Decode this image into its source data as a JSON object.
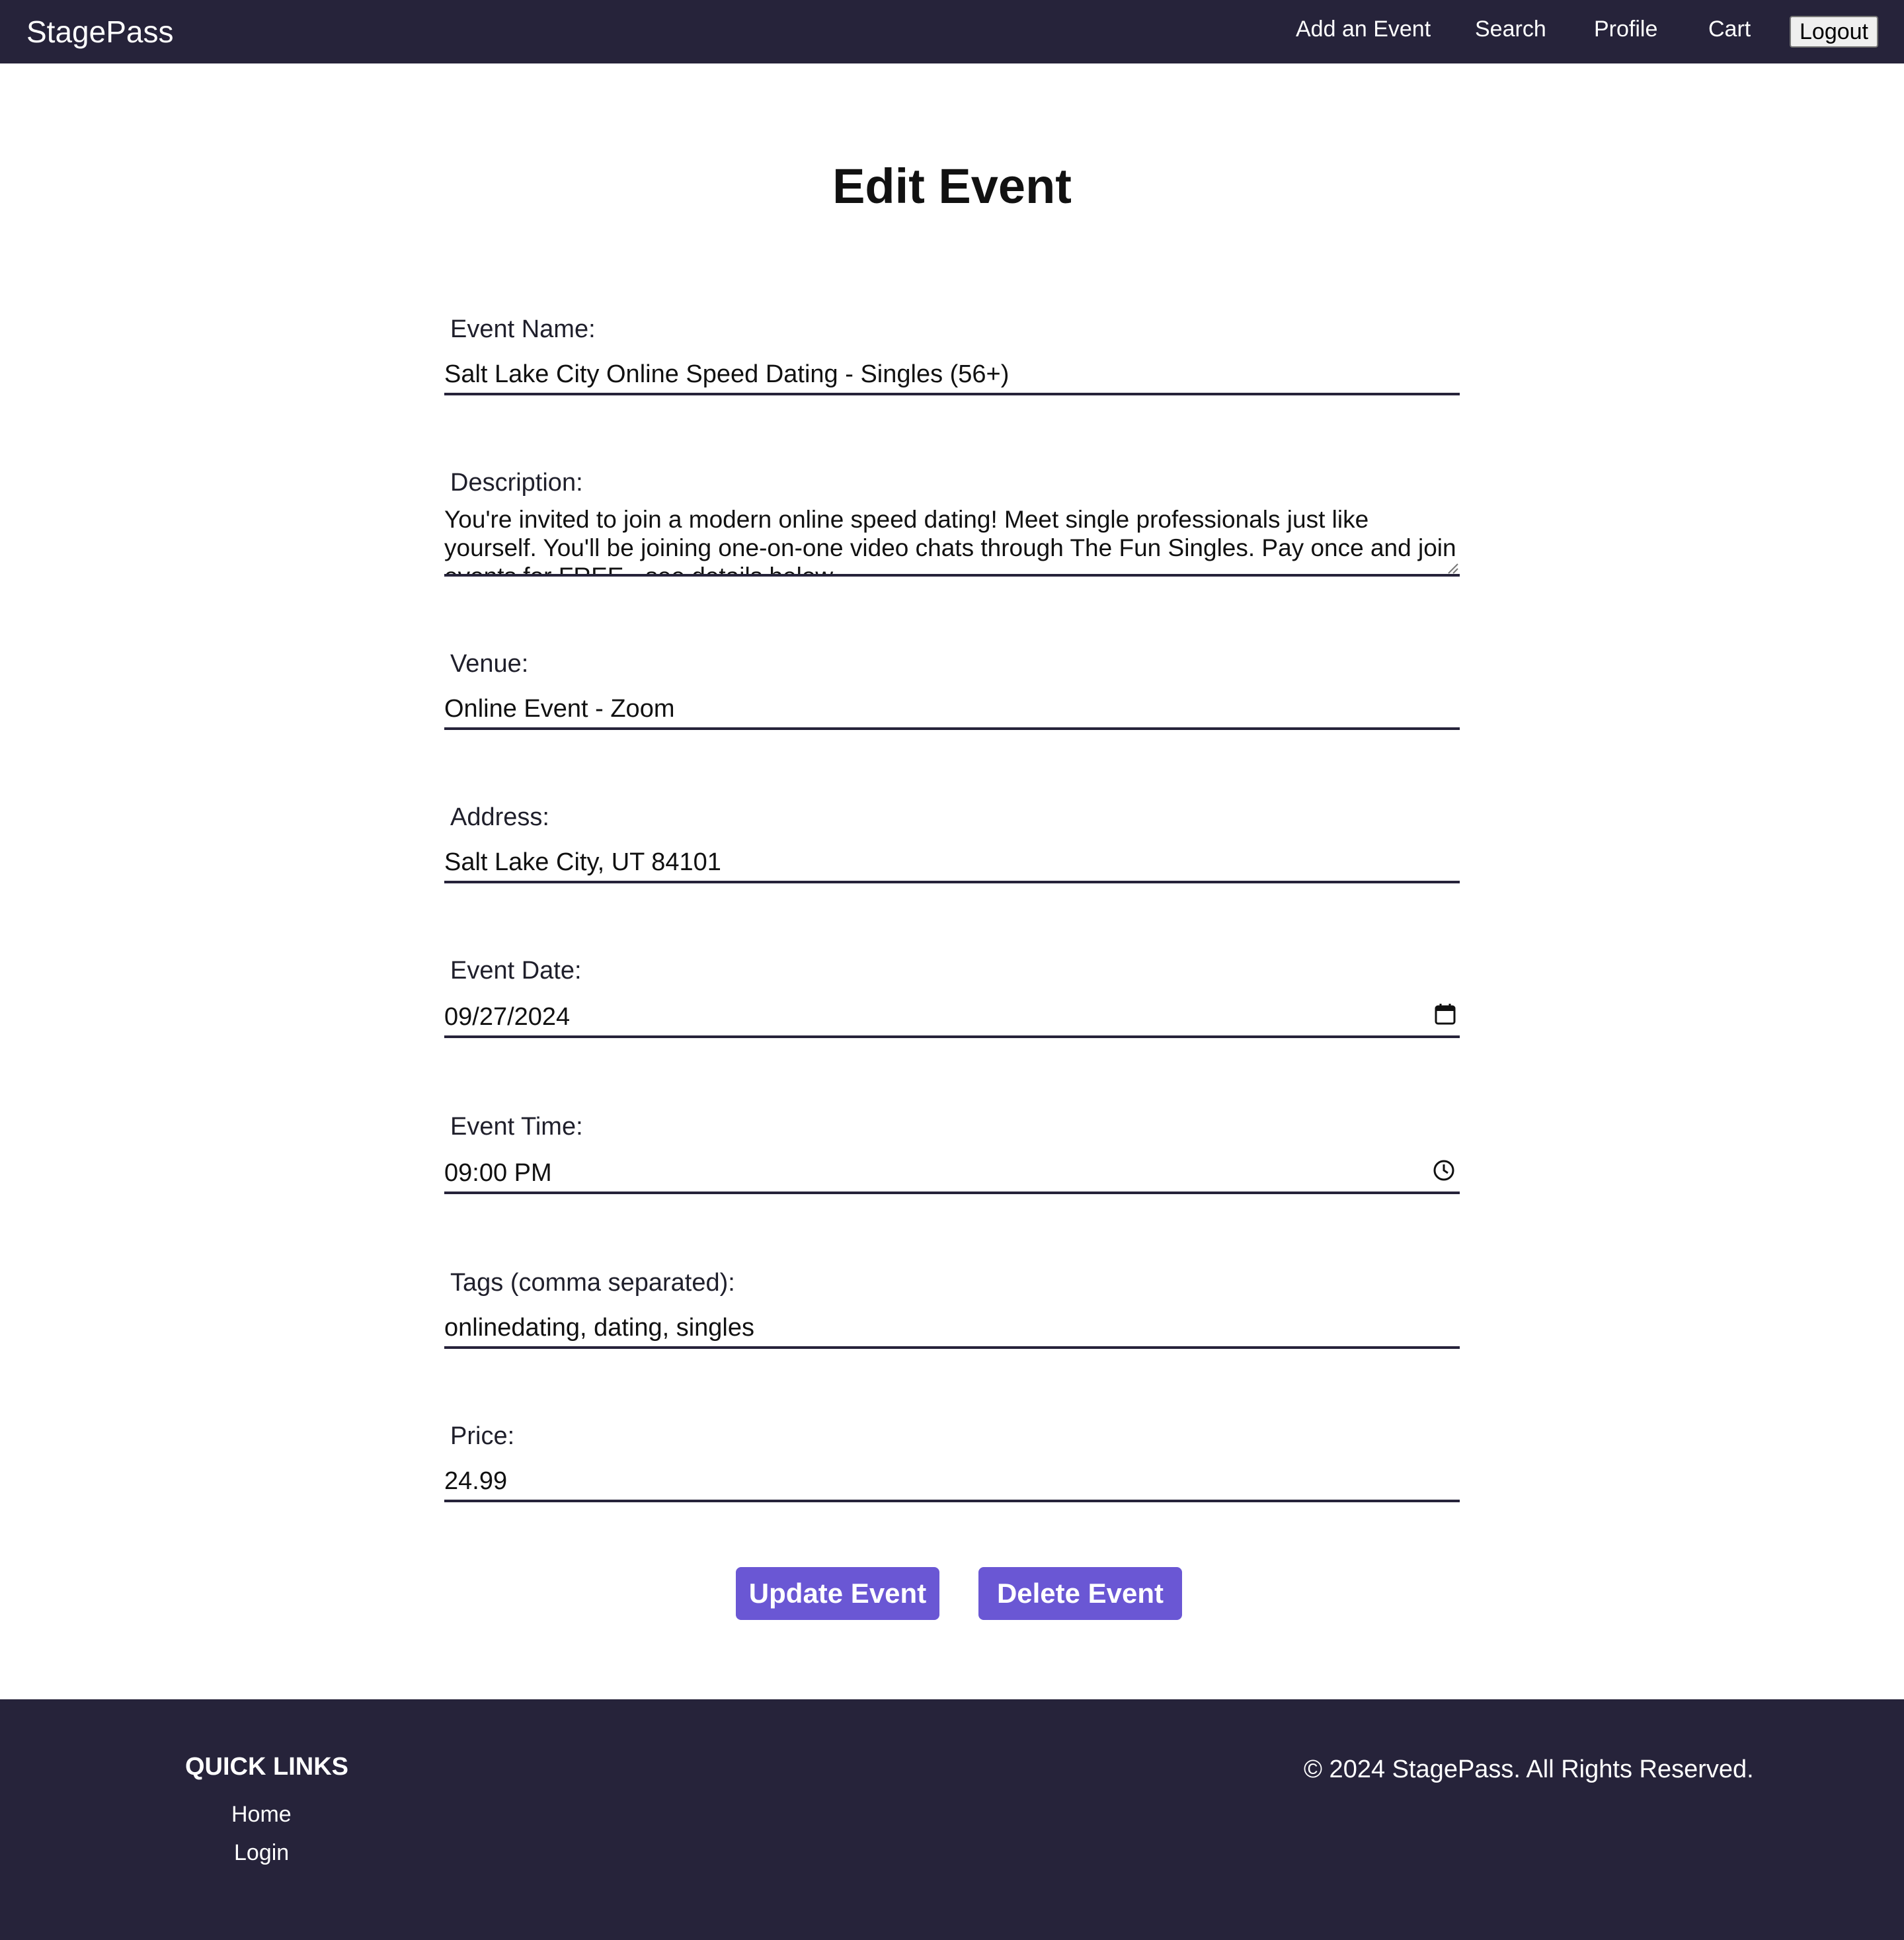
{
  "nav": {
    "brand": "StagePass",
    "add_event": "Add an Event",
    "search": "Search",
    "profile": "Profile",
    "cart": "Cart",
    "logout": "Logout"
  },
  "page": {
    "title": "Edit Event"
  },
  "form": {
    "event_name": {
      "label": "Event Name:",
      "value": "Salt Lake City Online Speed Dating - Singles (56+)"
    },
    "description": {
      "label": "Description:",
      "value": "You're invited to join a modern online speed dating! Meet single professionals just like yourself. You'll be joining one-on-one video chats through The Fun Singles. Pay once and join events for FREE - see details below."
    },
    "venue": {
      "label": "Venue:",
      "value": "Online Event - Zoom"
    },
    "address": {
      "label": "Address:",
      "value": "Salt Lake City, UT 84101"
    },
    "event_date": {
      "label": "Event Date:",
      "value": "09/27/2024",
      "icon": "calendar-icon"
    },
    "event_time": {
      "label": "Event Time:",
      "value": "09:00 PM",
      "icon": "clock-icon"
    },
    "tags": {
      "label": "Tags (comma separated):",
      "value": "onlinedating, dating, singles"
    },
    "price": {
      "label": "Price:",
      "value": "24.99"
    },
    "update_button": "Update Event",
    "delete_button": "Delete Event"
  },
  "footer": {
    "heading": "QUICK LINKS",
    "links": [
      "Home",
      "Login"
    ],
    "copyright": "© 2024 StagePass. All Rights Reserved."
  },
  "colors": {
    "nav_bg": "#26233a",
    "accent": "#6a57d4",
    "text": "#111111",
    "background": "#ffffff"
  }
}
